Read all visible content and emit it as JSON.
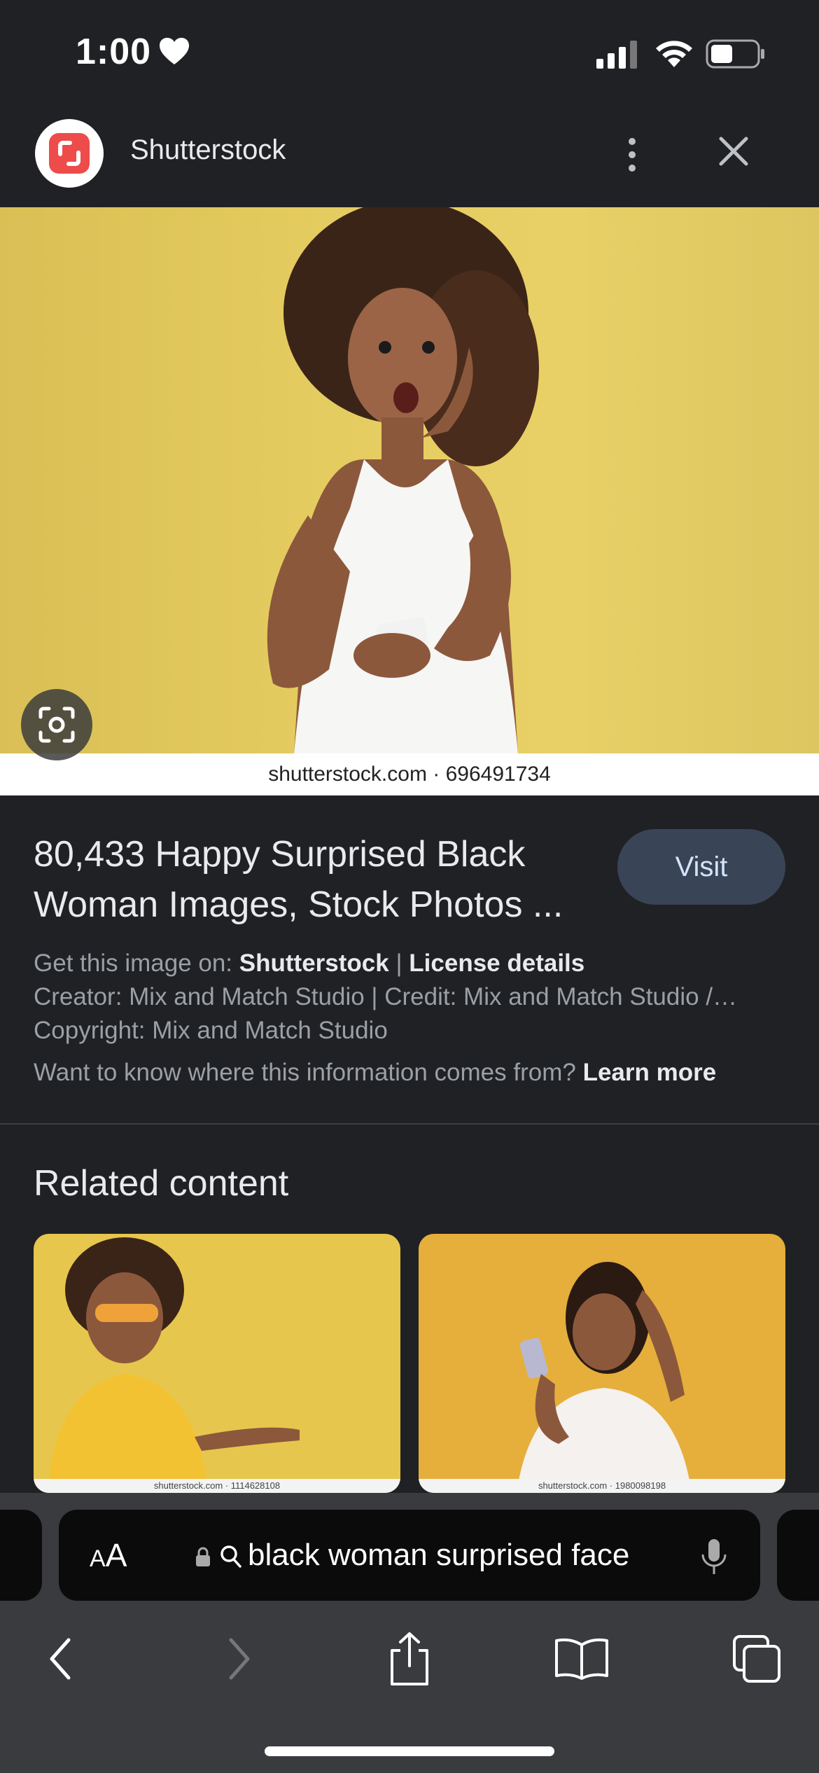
{
  "status_bar": {
    "time": "1:00",
    "icons": [
      "heart-icon",
      "cellular-signal-icon",
      "wifi-icon",
      "battery-icon"
    ]
  },
  "header": {
    "site_name": "Shutterstock",
    "logo_icon": "shutterstock-logo-icon",
    "more_icon": "more-vertical-icon",
    "close_icon": "close-icon"
  },
  "hero": {
    "watermark": "shutterstock.com · 696491734",
    "lens_icon": "google-lens-icon"
  },
  "result": {
    "title": "80,433 Happy Surprised Black Woman Images, Stock Photos ...",
    "visit_label": "Visit",
    "get_image_prefix": "Get this image on:",
    "get_image_source": "Shutterstock",
    "separator": "|",
    "license_details": "License details",
    "creator_line": "Creator: Mix and Match Studio | Credit: Mix and Match Studio /…",
    "copyright_line": "Copyright: Mix and Match Studio",
    "info_question": "Want to know where this information comes from?",
    "learn_more": "Learn more"
  },
  "related": {
    "title": "Related content",
    "items": [
      {
        "watermark": "shutterstock.com · 1114628108"
      },
      {
        "watermark": "shutterstock.com · 1980098198"
      }
    ]
  },
  "browser": {
    "aa_label_small": "A",
    "aa_label_large": "A",
    "url_text": "black woman surprised face",
    "icons": [
      "lock-icon",
      "search-icon",
      "microphone-icon",
      "back-icon",
      "forward-icon",
      "share-icon",
      "bookmarks-icon",
      "tabs-icon"
    ]
  },
  "colors": {
    "background": "#202124",
    "accent_button": "#394457",
    "brand_red": "#ee4b4b",
    "chrome_bar": "#3a3b3e"
  }
}
